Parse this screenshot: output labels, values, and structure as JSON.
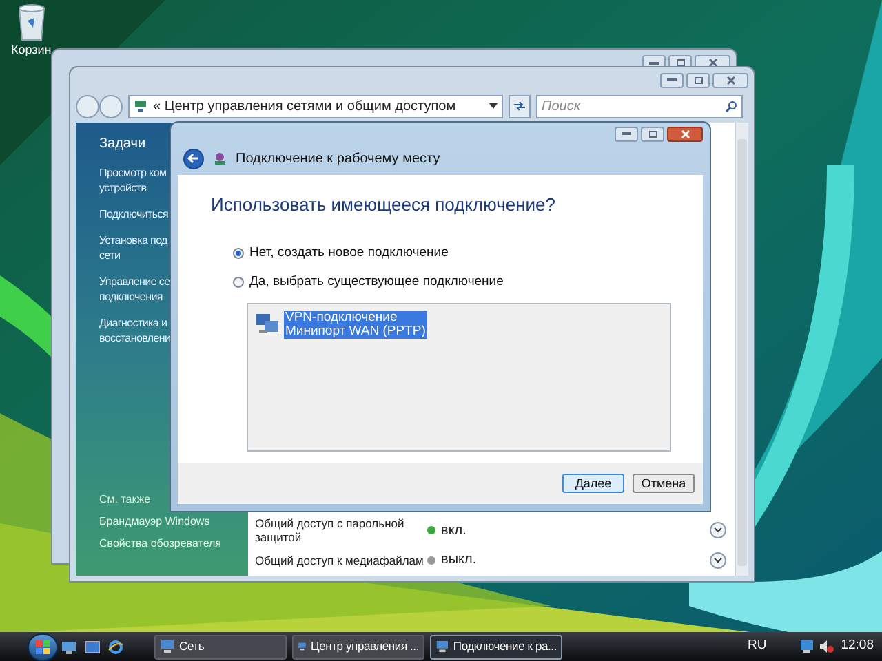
{
  "desktop": {
    "icons": [
      {
        "label": "Корзин"
      }
    ]
  },
  "network_window": {
    "address": "« Центр управления сетями и общим доступом",
    "search": {
      "placeholder": "Поиск"
    },
    "tasks_heading": "Задачи",
    "tasks": [
      {
        "lines": [
          "Просмотр ком",
          "устройств"
        ]
      },
      {
        "lines": [
          "Подключиться"
        ]
      },
      {
        "lines": [
          "Установка под",
          "сети"
        ]
      },
      {
        "lines": [
          "Управление се",
          "подключения"
        ]
      },
      {
        "lines": [
          "Диагностика и",
          "восстановлени"
        ]
      }
    ],
    "see_also_heading": "См. также",
    "see_also": [
      "Брандмауэр Windows",
      "Свойства обозревателя"
    ],
    "sharing": [
      {
        "label": "Общий доступ с парольной защитой",
        "status": "вкл.",
        "on": true
      },
      {
        "label": "Общий доступ к медиафайлам",
        "status": "выкл.",
        "on": false
      }
    ]
  },
  "dialog": {
    "title": "Подключение к рабочему месту",
    "heading": "Использовать имеющееся подключение?",
    "options": [
      {
        "label": "Нет, создать новое подключение",
        "selected": true
      },
      {
        "label": "Да, выбрать существующее подключение",
        "selected": false
      }
    ],
    "connections": [
      {
        "name": "VPN-подключение",
        "device": "Минипорт WAN (PPTP)",
        "selected": true
      }
    ],
    "buttons": [
      {
        "label": "Далее",
        "default": true
      },
      {
        "label": "Отмена",
        "default": false
      }
    ]
  },
  "taskbar": {
    "tasks": [
      {
        "label": "Сеть",
        "active": false
      },
      {
        "label": "Центр управления ...",
        "active": false
      },
      {
        "label": "Подключение к ра...",
        "active": true
      }
    ],
    "language": "RU",
    "clock": "12:08"
  }
}
